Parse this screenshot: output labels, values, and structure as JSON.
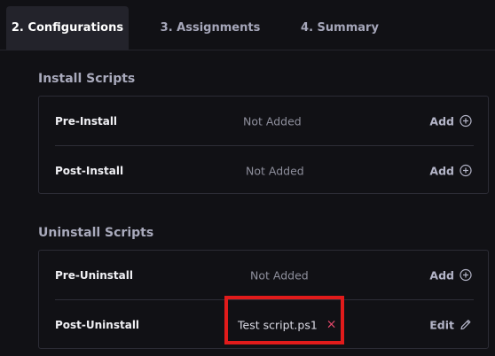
{
  "tabs": [
    {
      "label": "2. Configurations",
      "active": true
    },
    {
      "label": "3. Assignments",
      "active": false
    },
    {
      "label": "4. Summary",
      "active": false
    }
  ],
  "install": {
    "title": "Install Scripts",
    "rows": [
      {
        "label": "Pre-Install",
        "status": "Not Added",
        "action": "Add",
        "action_icon": "plus-circle-icon"
      },
      {
        "label": "Post-Install",
        "status": "Not Added",
        "action": "Add",
        "action_icon": "plus-circle-icon"
      }
    ]
  },
  "uninstall": {
    "title": "Uninstall Scripts",
    "rows": [
      {
        "label": "Pre-Uninstall",
        "status": "Not Added",
        "action": "Add",
        "action_icon": "plus-circle-icon"
      },
      {
        "label": "Post-Uninstall",
        "file": "Test script.ps1",
        "remove_symbol": "×",
        "action": "Edit",
        "action_icon": "pencil-icon"
      }
    ]
  },
  "colors": {
    "background": "#111115",
    "active_tab": "#23232b",
    "highlight": "#e11b1b",
    "remove": "#e5486a"
  }
}
